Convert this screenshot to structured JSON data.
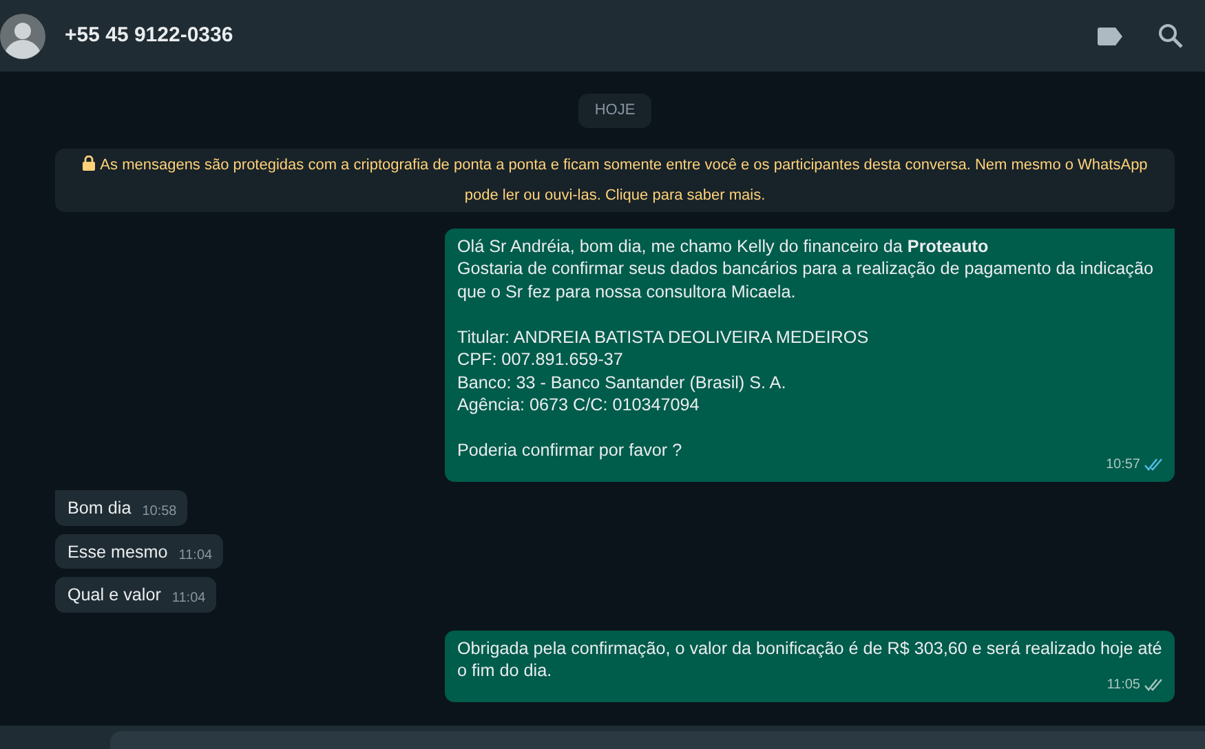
{
  "contact": {
    "name": "+55 45 9122-0336"
  },
  "date_chip": "HOJE",
  "encryption_notice": "As mensagens são protegidas com a criptografia de ponta a ponta e ficam somente entre você e os participantes desta conversa. Nem mesmo o WhatsApp pode ler ou ouvi-las. Clique para saber mais.",
  "messages": [
    {
      "kind": "outgoing",
      "tail": true,
      "text": "Olá Sr Andréia, bom dia, me chamo Kelly do financeiro da **Proteauto**\nGostaria de confirmar seus dados bancários para a realização de pagamento da indicação que o Sr fez para nossa consultora Micaela.\n\nTitular: ANDREIA BATISTA DEOLIVEIRA MEDEIROS\nCPF: 007.891.659-37\nBanco: 33 - Banco Santander (Brasil) S. A.\nAgência: 0673 C/C: 010347094\n\nPoderia confirmar por favor ?",
      "time": "10:57",
      "read": true
    },
    {
      "kind": "incoming",
      "tail": true,
      "text": "Bom dia",
      "time": "10:58"
    },
    {
      "kind": "incoming",
      "tail": false,
      "text": "Esse mesmo",
      "time": "11:04"
    },
    {
      "kind": "incoming",
      "tail": false,
      "text": "Qual e valor",
      "time": "11:04"
    },
    {
      "kind": "outgoing",
      "tail": false,
      "text": "Obrigada pela confirmação, o valor da bonificação é de R$ 303,60 e será realizado hoje até o fim do dia.",
      "time": "11:05",
      "read": false
    }
  ]
}
